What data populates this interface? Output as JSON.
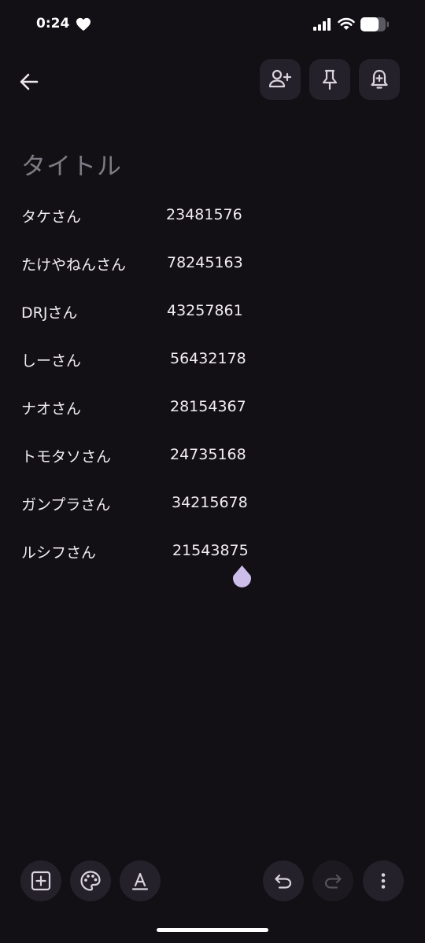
{
  "status_bar": {
    "time": "0:24"
  },
  "note": {
    "title_placeholder": "タイトル",
    "entries": [
      {
        "name": "タケさん",
        "number": "23481576"
      },
      {
        "name": "たけやねんさん",
        "number": "78245163"
      },
      {
        "name": "DRJさん",
        "number": "43257861"
      },
      {
        "name": "しーさん",
        "number": "56432178"
      },
      {
        "name": "ナオさん",
        "number": "28154367"
      },
      {
        "name": "トモタソさん",
        "number": "24735168"
      },
      {
        "name": "ガンプラさん",
        "number": "34215678"
      },
      {
        "name": "ルシフさん",
        "number": "21543875"
      }
    ]
  },
  "icons": {
    "back": "arrow-left-icon",
    "collaborator": "person-add-icon",
    "pin": "pin-icon",
    "reminder": "bell-plus-icon",
    "add": "add-box-icon",
    "palette": "palette-icon",
    "text_format": "text-format-icon",
    "undo": "undo-icon",
    "redo": "redo-icon",
    "more": "more-vertical-icon"
  },
  "colors": {
    "background": "#121015",
    "button_surface": "#24212A",
    "text": "#F1EDF3",
    "placeholder": "#7E7A84",
    "cursor_accent": "#CDBDEB"
  }
}
